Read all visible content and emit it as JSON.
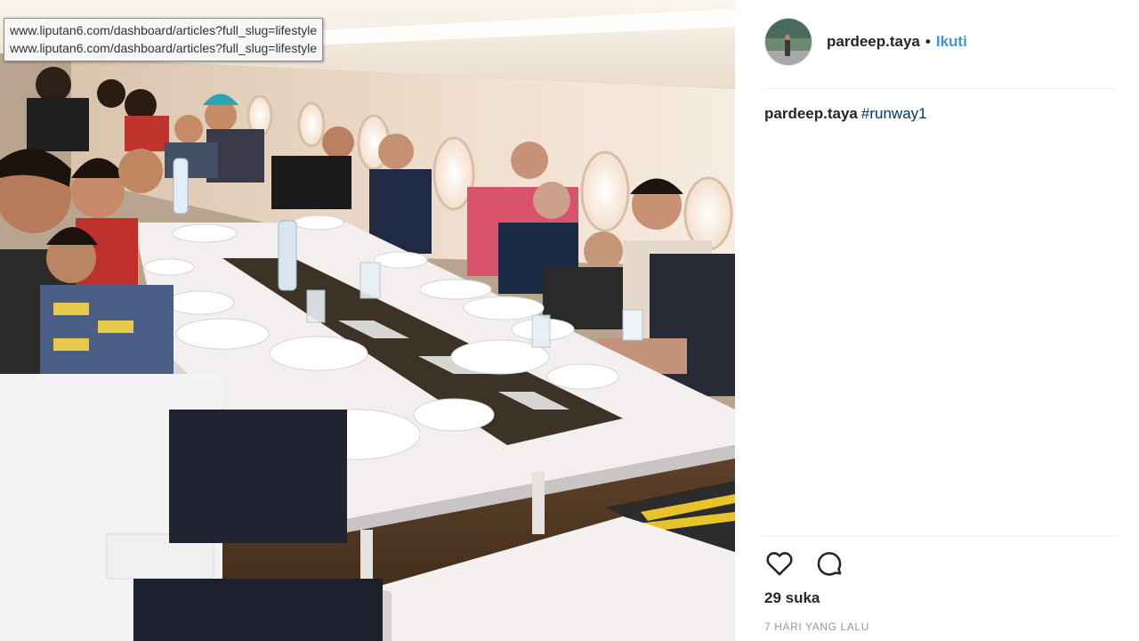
{
  "tooltip": {
    "lines": [
      "www.liputan6.com/dashboard/articles?full_slug=lifestyle",
      "www.liputan6.com/dashboard/articles?full_slug=lifestyle"
    ]
  },
  "post": {
    "username": "pardeep.taya",
    "separator": "•",
    "follow_label": "Ikuti",
    "caption": {
      "username": "pardeep.taya",
      "hashtag": "#runway1"
    },
    "likes": "29 suka",
    "time": "7 HARI YANG LALU"
  },
  "icons": {
    "like": "heart-icon",
    "comment": "comment-bubble-icon"
  },
  "colors": {
    "follow": "#3897f0",
    "hashtag": "#003569",
    "time": "#999999"
  }
}
